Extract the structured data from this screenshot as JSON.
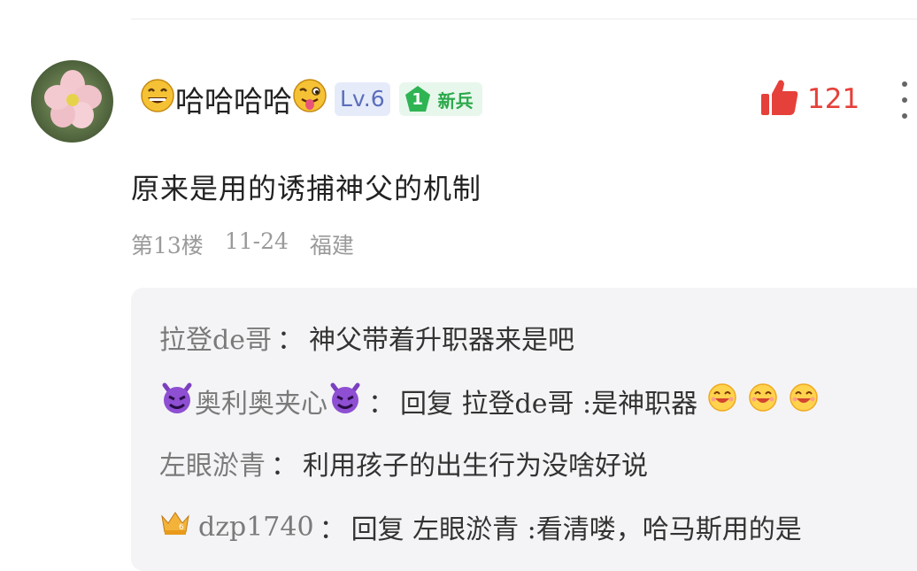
{
  "comment": {
    "username": "哈哈哈哈",
    "level": "Lv.6",
    "rank_number": "1",
    "rank_label": "新兵",
    "like_count": "121",
    "content": "原来是用的诱捕神父的机制",
    "floor": "第13楼",
    "date": "11-24",
    "location": "福建"
  },
  "replies": [
    {
      "name": "拉登de哥",
      "sep": "：",
      "text": "神父带着升职器来是吧"
    },
    {
      "name": "奥利奥夹心",
      "sep": "：",
      "text": "回复 拉登de哥 :是神职器"
    },
    {
      "name": "左眼淤青",
      "sep": "：",
      "text": "利用孩子的出生行为没啥好说"
    },
    {
      "name": "dzp1740",
      "sep": "：",
      "text": "回复 左眼淤青 :看清喽，哈马斯用的是"
    }
  ],
  "colors": {
    "like": "#e6403a",
    "level_badge_bg": "#e6ebfa",
    "rank_green": "#2aa84a"
  },
  "icons": {
    "avatar": "flower-avatar",
    "like": "thumbs-up-icon",
    "more": "more-vertical-icon"
  }
}
